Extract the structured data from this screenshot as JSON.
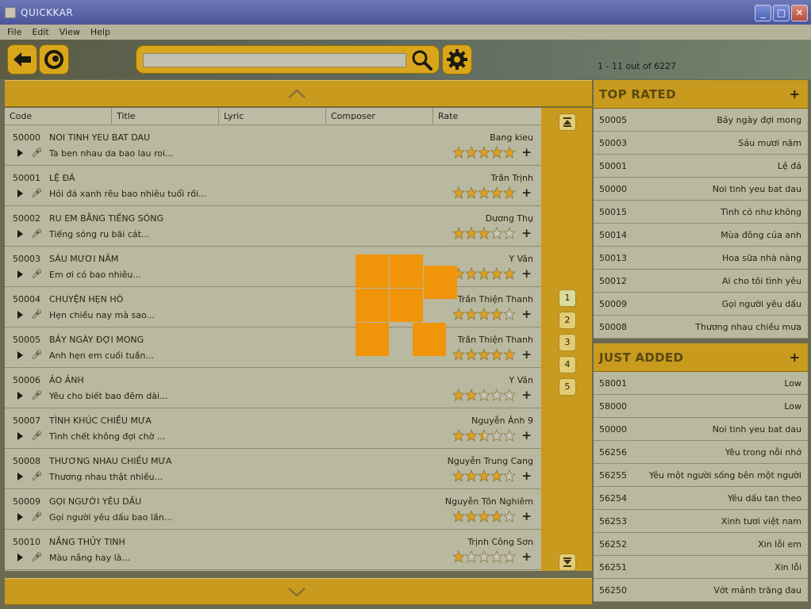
{
  "window": {
    "title": "QUICKKAR"
  },
  "menu": [
    "File",
    "Edit",
    "View",
    "Help"
  ],
  "toolbar": {
    "back_icon": "arrow-left-icon",
    "home_icon": "swirl-icon",
    "search_placeholder": "",
    "search_value": "",
    "search_icon": "magnifier-icon",
    "settings_icon": "gear-icon",
    "count_text": "1 - 11 out of 6227"
  },
  "columns": [
    "Code",
    "Title",
    "Lyric",
    "Composer",
    "Rate"
  ],
  "songs": [
    {
      "code": "50000",
      "title": "NOI TINH YEU BAT DAU",
      "composer": "Bang kieu",
      "lyric": "Ta ben nhau da bao lau roi...",
      "rating": 5
    },
    {
      "code": "50001",
      "title": "LỆ ĐÁ",
      "composer": "Trần Trịnh",
      "lyric": "Hỏi đá xanh rêu bao nhiêu tuổi rồi...",
      "rating": 5
    },
    {
      "code": "50002",
      "title": "RU EM BẰNG TIẾNG SÓNG",
      "composer": "Dương Thụ",
      "lyric": "Tiếng sóng ru bãi cát...",
      "rating": 3
    },
    {
      "code": "50003",
      "title": "SÁU MƯƠI NĂM",
      "composer": "Y Vân",
      "lyric": "Em ơi có bao nhiêu...",
      "rating": 5
    },
    {
      "code": "50004",
      "title": "CHUYỆN HẸN HÒ",
      "composer": "Trần Thiện Thanh",
      "lyric": "Hẹn chiều nay mà sao...",
      "rating": 4
    },
    {
      "code": "50005",
      "title": "BẢY NGÀY ĐỢI MONG",
      "composer": "Trần Thiện Thanh",
      "lyric": "Anh hẹn em cuối tuần...",
      "rating": 5
    },
    {
      "code": "50006",
      "title": "ẢO ẢNH",
      "composer": "Y Vân",
      "lyric": "Yêu cho biết bao đêm dài...",
      "rating": 2
    },
    {
      "code": "50007",
      "title": "TÌNH KHÚC CHIỀU MƯA",
      "composer": "Nguyễn Ánh 9",
      "lyric": "Tình chết không đợi chờ ...",
      "rating": 2.5
    },
    {
      "code": "50008",
      "title": "THƯƠNG NHAU CHIỀU MƯA",
      "composer": "Nguyễn Trung Cang",
      "lyric": "Thương nhau thật nhiều...",
      "rating": 4
    },
    {
      "code": "50009",
      "title": "GỌI NGƯỜI YÊU DẤU",
      "composer": "Nguyễn Tôn Nghiêm",
      "lyric": "Gọi người yêu dấu bao lần...",
      "rating": 4
    },
    {
      "code": "50010",
      "title": "NẮNG THỦY TINH",
      "composer": "Trịnh Công Sơn",
      "lyric": "Màu nắng hay là...",
      "rating": 1
    }
  ],
  "pages": [
    "1",
    "2",
    "3",
    "4",
    "5"
  ],
  "active_page": "1",
  "top_rated": {
    "title": "TOP RATED",
    "items": [
      {
        "code": "50005",
        "title": "Bảy ngày đợi mong"
      },
      {
        "code": "50003",
        "title": "Sáu mươi năm"
      },
      {
        "code": "50001",
        "title": "Lệ đá"
      },
      {
        "code": "50000",
        "title": "Noi tinh yeu bat dau"
      },
      {
        "code": "50015",
        "title": "Tình có như không"
      },
      {
        "code": "50014",
        "title": "Mùa đông của anh"
      },
      {
        "code": "50013",
        "title": "Hoa sữa nhà nàng"
      },
      {
        "code": "50012",
        "title": "Ai cho tôi tình yêu"
      },
      {
        "code": "50009",
        "title": "Gọi người yêu dấu"
      },
      {
        "code": "50008",
        "title": "Thương nhau chiều mưa"
      }
    ]
  },
  "just_added": {
    "title": "JUST ADDED",
    "items": [
      {
        "code": "58001",
        "title": "Low"
      },
      {
        "code": "58000",
        "title": "Low"
      },
      {
        "code": "50000",
        "title": "Noi tinh yeu bat dau"
      },
      {
        "code": "56256",
        "title": "Yêu trong nỗi nhớ"
      },
      {
        "code": "56255",
        "title": "Yêu một người sống bên một người"
      },
      {
        "code": "56254",
        "title": "Yêu dấu tan theo"
      },
      {
        "code": "56253",
        "title": "Xinh tươi việt nam"
      },
      {
        "code": "56252",
        "title": "Xin lỗi em"
      },
      {
        "code": "56251",
        "title": "Xin lỗi"
      },
      {
        "code": "56250",
        "title": "Vớt mảnh trăng đau"
      }
    ]
  },
  "colors": {
    "accent": "#d9a51a",
    "panel": "#b9b8a0",
    "loading": "#f0940a",
    "star_on": "#e0a020",
    "star_off": "#c8c6b8"
  }
}
